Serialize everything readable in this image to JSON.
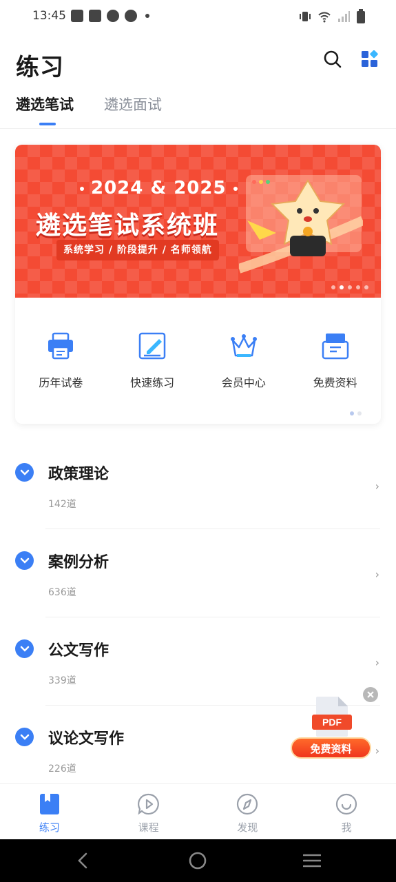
{
  "status_bar": {
    "time": "13:45",
    "left_icons": [
      "bag-icon",
      "bag-icon",
      "gauge-icon",
      "gauge-icon",
      "dot-icon"
    ],
    "right_icons": [
      "vibrate-icon",
      "wifi-icon",
      "signal-icon",
      "battery-icon"
    ]
  },
  "header": {
    "title": "练习",
    "actions": [
      "search-icon",
      "apps-grid-icon"
    ]
  },
  "tabs": [
    {
      "label": "遴选笔试",
      "active": true
    },
    {
      "label": "遴选面试",
      "active": false
    }
  ],
  "banner": {
    "year_left": "2024",
    "year_amp": "&",
    "year_right": "2025",
    "title": "遴选笔试系统班",
    "subtitle": "系统学习 / 阶段提升 / 名师领航",
    "slide_count": 5,
    "active_slide": 1
  },
  "quick_links": [
    {
      "label": "历年试卷",
      "icon": "printer-icon"
    },
    {
      "label": "快速练习",
      "icon": "edit-note-icon"
    },
    {
      "label": "会员中心",
      "icon": "crown-icon"
    },
    {
      "label": "免费资料",
      "icon": "file-tray-icon"
    }
  ],
  "quick_pages": 2,
  "categories": [
    {
      "name": "政策理论",
      "count": "142道"
    },
    {
      "name": "案例分析",
      "count": "636道"
    },
    {
      "name": "公文写作",
      "count": "339道"
    },
    {
      "name": "议论文写作",
      "count": "226道"
    }
  ],
  "promo": {
    "file_type": "PDF",
    "button_label": "免费资料"
  },
  "bottom_nav": [
    {
      "label": "练习",
      "icon": "book-icon",
      "active": true
    },
    {
      "label": "课程",
      "icon": "play-bubble-icon",
      "active": false
    },
    {
      "label": "发现",
      "icon": "compass-icon",
      "active": false
    },
    {
      "label": "我",
      "icon": "smile-icon",
      "active": false
    }
  ],
  "colors": {
    "accent": "#3b7ff5",
    "banner_red": "#f44b34",
    "promo_orange": "#f0361d"
  }
}
